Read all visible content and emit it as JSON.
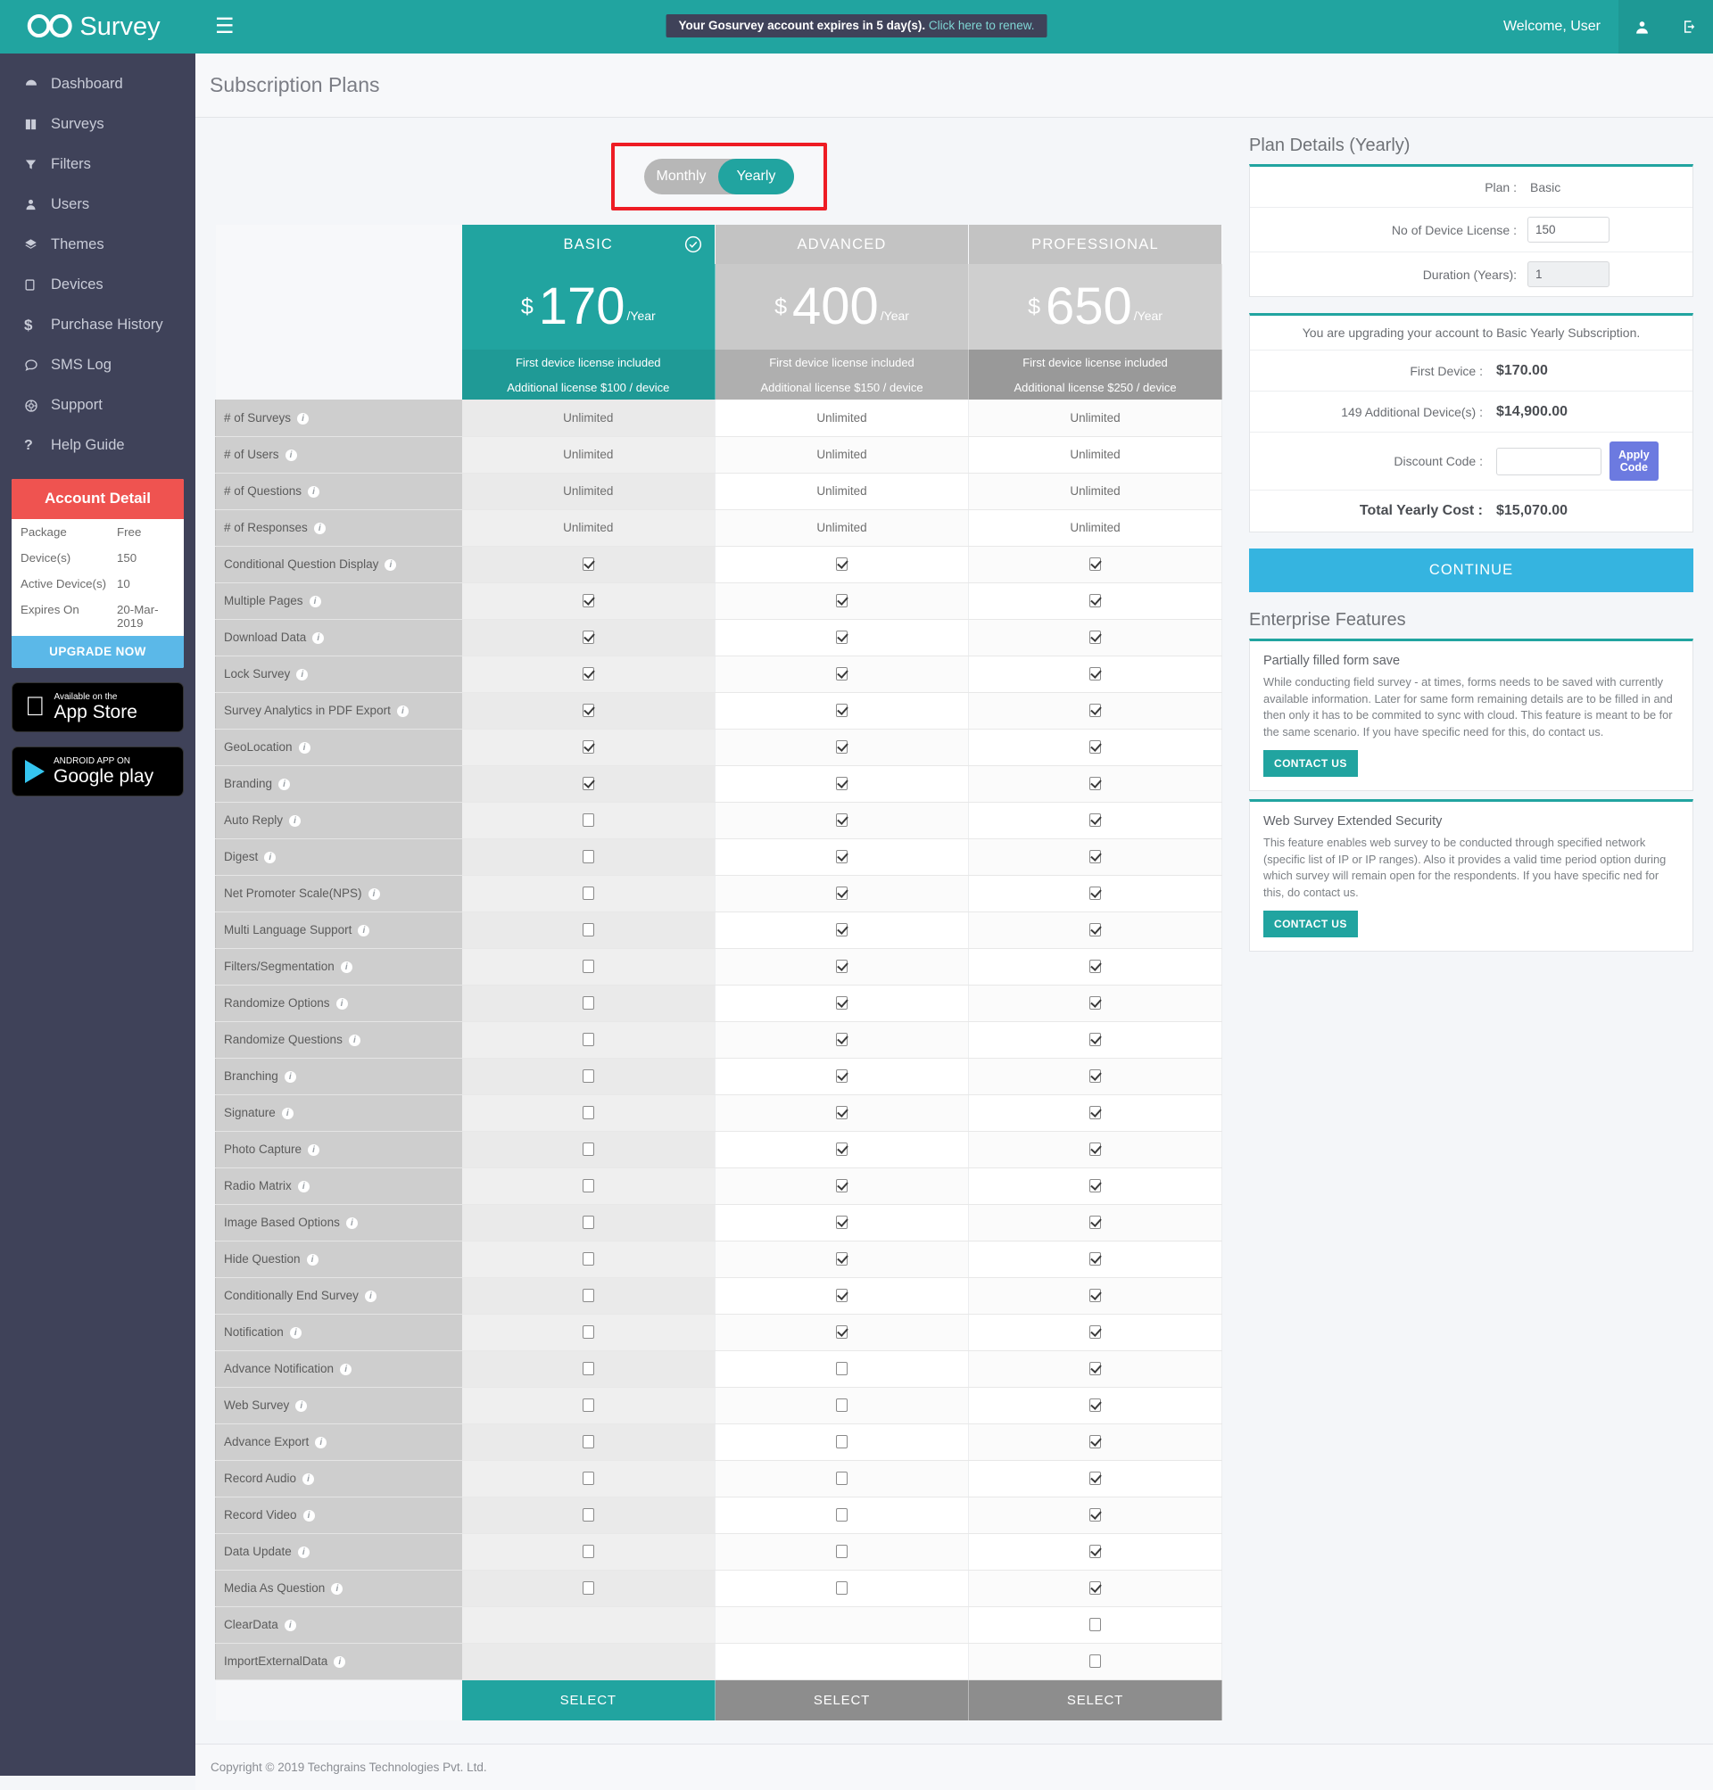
{
  "topbar": {
    "logo_glyph": "CO",
    "brand": "Survey",
    "hamburger_icon": "hamburger-menu-icon",
    "notice_text": "Your Gosurvey account expires in 5 day(s).",
    "notice_link": "Click here to renew.",
    "welcome": "Welcome, User",
    "user_icon": "user-icon",
    "logout_icon": "logout-icon"
  },
  "sidebar": {
    "items": [
      {
        "label": "Dashboard",
        "icon": "dashboard-icon"
      },
      {
        "label": "Surveys",
        "icon": "surveys-icon"
      },
      {
        "label": "Filters",
        "icon": "filter-icon"
      },
      {
        "label": "Users",
        "icon": "users-icon"
      },
      {
        "label": "Themes",
        "icon": "themes-layers-icon"
      },
      {
        "label": "Devices",
        "icon": "device-icon"
      },
      {
        "label": "Purchase History",
        "icon": "dollar-icon"
      },
      {
        "label": "SMS Log",
        "icon": "chat-icon"
      },
      {
        "label": "Support",
        "icon": "support-globe-icon"
      },
      {
        "label": "Help Guide",
        "icon": "question-mark-icon"
      }
    ],
    "account": {
      "title": "Account Detail",
      "rows": [
        {
          "key": "Package",
          "value": "Free"
        },
        {
          "key": "Device(s)",
          "value": "150"
        },
        {
          "key": "Active Device(s)",
          "value": "10"
        },
        {
          "key": "Expires On",
          "value": "20-Mar-2019"
        }
      ],
      "upgrade_label": "UPGRADE NOW"
    },
    "stores": [
      {
        "line1": "Available on the",
        "line2": "App Store",
        "icon": "apple-icon"
      },
      {
        "line1": "ANDROID APP ON",
        "line2": "Google play",
        "icon": "google-play-icon"
      }
    ]
  },
  "page": {
    "title": "Subscription Plans"
  },
  "billing_toggle": {
    "monthly": "Monthly",
    "yearly": "Yearly",
    "selected": "Yearly"
  },
  "plans": [
    {
      "name": "BASIC",
      "currency": "$",
      "amount": "170",
      "period": "/Year",
      "first_device": "First device license included",
      "additional": "Additional license $100 / device",
      "select_label": "SELECT",
      "selected": true
    },
    {
      "name": "ADVANCED",
      "currency": "$",
      "amount": "400",
      "period": "/Year",
      "first_device": "First device license included",
      "additional": "Additional license $150 / device",
      "select_label": "SELECT",
      "selected": false
    },
    {
      "name": "PROFESSIONAL",
      "currency": "$",
      "amount": "650",
      "period": "/Year",
      "first_device": "First device license included",
      "additional": "Additional license $250 / device",
      "select_label": "SELECT",
      "selected": false
    }
  ],
  "features": [
    {
      "label": "# of Surveys",
      "values": [
        "Unlimited",
        "Unlimited",
        "Unlimited"
      ]
    },
    {
      "label": "# of Users",
      "values": [
        "Unlimited",
        "Unlimited",
        "Unlimited"
      ]
    },
    {
      "label": "# of Questions",
      "values": [
        "Unlimited",
        "Unlimited",
        "Unlimited"
      ]
    },
    {
      "label": "# of Responses",
      "values": [
        "Unlimited",
        "Unlimited",
        "Unlimited"
      ]
    },
    {
      "label": "Conditional Question Display",
      "values": [
        "checked",
        "checked",
        "checked"
      ]
    },
    {
      "label": "Multiple Pages",
      "values": [
        "checked",
        "checked",
        "checked"
      ]
    },
    {
      "label": "Download Data",
      "values": [
        "checked",
        "checked",
        "checked"
      ]
    },
    {
      "label": "Lock Survey",
      "values": [
        "checked",
        "checked",
        "checked"
      ]
    },
    {
      "label": "Survey Analytics in PDF Export",
      "values": [
        "checked",
        "checked",
        "checked"
      ]
    },
    {
      "label": "GeoLocation",
      "values": [
        "checked",
        "checked",
        "checked"
      ]
    },
    {
      "label": "Branding",
      "values": [
        "checked",
        "checked",
        "checked"
      ]
    },
    {
      "label": "Auto Reply",
      "values": [
        "unchecked",
        "checked",
        "checked"
      ]
    },
    {
      "label": "Digest",
      "values": [
        "unchecked",
        "checked",
        "checked"
      ]
    },
    {
      "label": "Net Promoter Scale(NPS)",
      "values": [
        "unchecked",
        "checked",
        "checked"
      ]
    },
    {
      "label": "Multi Language Support",
      "values": [
        "unchecked",
        "checked",
        "checked"
      ]
    },
    {
      "label": "Filters/Segmentation",
      "values": [
        "unchecked",
        "checked",
        "checked"
      ]
    },
    {
      "label": "Randomize Options",
      "values": [
        "unchecked",
        "checked",
        "checked"
      ]
    },
    {
      "label": "Randomize Questions",
      "values": [
        "unchecked",
        "checked",
        "checked"
      ]
    },
    {
      "label": "Branching",
      "values": [
        "unchecked",
        "checked",
        "checked"
      ]
    },
    {
      "label": "Signature",
      "values": [
        "unchecked",
        "checked",
        "checked"
      ]
    },
    {
      "label": "Photo Capture",
      "values": [
        "unchecked",
        "checked",
        "checked"
      ]
    },
    {
      "label": "Radio Matrix",
      "values": [
        "unchecked",
        "checked",
        "checked"
      ]
    },
    {
      "label": "Image Based Options",
      "values": [
        "unchecked",
        "checked",
        "checked"
      ]
    },
    {
      "label": "Hide Question",
      "values": [
        "unchecked",
        "checked",
        "checked"
      ]
    },
    {
      "label": "Conditionally End Survey",
      "values": [
        "unchecked",
        "checked",
        "checked"
      ]
    },
    {
      "label": "Notification",
      "values": [
        "unchecked",
        "checked",
        "checked"
      ]
    },
    {
      "label": "Advance Notification",
      "values": [
        "unchecked",
        "unchecked",
        "checked"
      ]
    },
    {
      "label": "Web Survey",
      "values": [
        "unchecked",
        "unchecked",
        "checked"
      ]
    },
    {
      "label": "Advance Export",
      "values": [
        "unchecked",
        "unchecked",
        "checked"
      ]
    },
    {
      "label": "Record Audio",
      "values": [
        "unchecked",
        "unchecked",
        "checked"
      ]
    },
    {
      "label": "Record Video",
      "values": [
        "unchecked",
        "unchecked",
        "checked"
      ]
    },
    {
      "label": "Data Update",
      "values": [
        "unchecked",
        "unchecked",
        "checked"
      ]
    },
    {
      "label": "Media As Question",
      "values": [
        "unchecked",
        "unchecked",
        "checked"
      ]
    },
    {
      "label": "ClearData",
      "values": [
        "none",
        "none",
        "unchecked"
      ]
    },
    {
      "label": "ImportExternalData",
      "values": [
        "none",
        "none",
        "unchecked"
      ]
    }
  ],
  "plan_details": {
    "title": "Plan Details (Yearly)",
    "plan_label": "Plan :",
    "plan_value": "Basic",
    "device_license_label": "No of Device License :",
    "device_license_value": "150",
    "duration_label": "Duration (Years):",
    "duration_value": "1",
    "upgrade_note": "You are upgrading your account to Basic Yearly Subscription.",
    "first_device_label": "First Device :",
    "first_device_value": "$170.00",
    "additional_label": "149 Additional Device(s) :",
    "additional_value": "$14,900.00",
    "discount_label": "Discount Code :",
    "discount_value": "",
    "discount_placeholder": "",
    "apply_label": "Apply Code",
    "total_label": "Total Yearly Cost :",
    "total_value": "$15,070.00",
    "continue_label": "CONTINUE"
  },
  "enterprise": {
    "title": "Enterprise Features",
    "items": [
      {
        "title": "Partially filled form save",
        "body": "While conducting field survey - at times, forms needs to be saved with currently available information. Later for same form remaining details are to be filled in and then only it has to be commited to sync with cloud. This feature is meant to be for the same scenario. If you have specific need for this, do contact us.",
        "button": "CONTACT US"
      },
      {
        "title": "Web Survey Extended Security",
        "body": "This feature enables web survey to be conducted through specified network (specific list of IP or IP ranges). Also it provides a valid time period option during which survey will remain open for the respondents. If you have specific ned for this, do contact us.",
        "button": "CONTACT US"
      }
    ]
  },
  "footer": {
    "copyright": "Copyright © 2019 Techgrains Technologies Pvt. Ltd."
  },
  "colors": {
    "brand_teal": "#21a4a0",
    "sidebar_dark": "#3f4259",
    "account_red": "#ef5350",
    "continue_blue": "#35b4e0",
    "apply_purple": "#6c7ae0",
    "highlight_red": "#ee1c24"
  }
}
